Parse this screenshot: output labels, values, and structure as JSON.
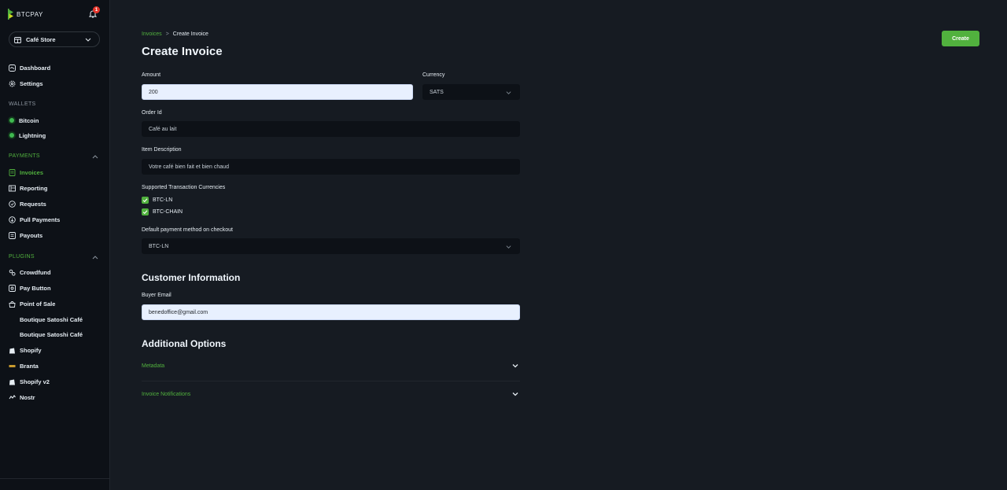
{
  "brand": {
    "logo_text": "BTCPAY",
    "notification_count": "1"
  },
  "store": {
    "name": "Café Store"
  },
  "sidebar": {
    "main": [
      {
        "label": "Dashboard"
      },
      {
        "label": "Settings"
      }
    ],
    "wallets_label": "WALLETS",
    "wallets": [
      {
        "label": "Bitcoin"
      },
      {
        "label": "Lightning"
      }
    ],
    "payments_label": "PAYMENTS",
    "payments": [
      {
        "label": "Invoices"
      },
      {
        "label": "Reporting"
      },
      {
        "label": "Requests"
      },
      {
        "label": "Pull Payments"
      },
      {
        "label": "Payouts"
      }
    ],
    "plugins_label": "PLUGINS",
    "plugins": [
      {
        "label": "Crowdfund"
      },
      {
        "label": "Pay Button"
      },
      {
        "label": "Point of Sale"
      },
      {
        "label": "Boutique Satoshi Café"
      },
      {
        "label": "Boutique Satoshi Café"
      },
      {
        "label": "Shopify"
      },
      {
        "label": "Branta"
      },
      {
        "label": "Shopify v2"
      },
      {
        "label": "Nostr"
      }
    ]
  },
  "breadcrumb": {
    "parent": "Invoices",
    "separator": ">",
    "current": "Create Invoice"
  },
  "page": {
    "title": "Create Invoice",
    "create_label": "Create"
  },
  "form": {
    "amount_label": "Amount",
    "amount_value": "200",
    "currency_label": "Currency",
    "currency_value": "SATS",
    "order_id_label": "Order Id",
    "order_id_value": "Café au lait",
    "item_desc_label": "Item Description",
    "item_desc_value": "Votre café bien fait et bien chaud",
    "supported_label": "Supported Transaction Currencies",
    "supported": [
      {
        "label": "BTC-LN",
        "checked": true
      },
      {
        "label": "BTC-CHAIN",
        "checked": true
      }
    ],
    "default_method_label": "Default payment method on checkout",
    "default_method_value": "BTC-LN"
  },
  "customer": {
    "title": "Customer Information",
    "buyer_email_label": "Buyer Email",
    "buyer_email_value": "benedoffice@gmail.com"
  },
  "additional": {
    "title": "Additional Options",
    "metadata_label": "Metadata",
    "notifications_label": "Invoice Notifications"
  },
  "colors": {
    "accent": "#51b13e",
    "background": "#161b22",
    "sidebar": "#0d1117"
  }
}
